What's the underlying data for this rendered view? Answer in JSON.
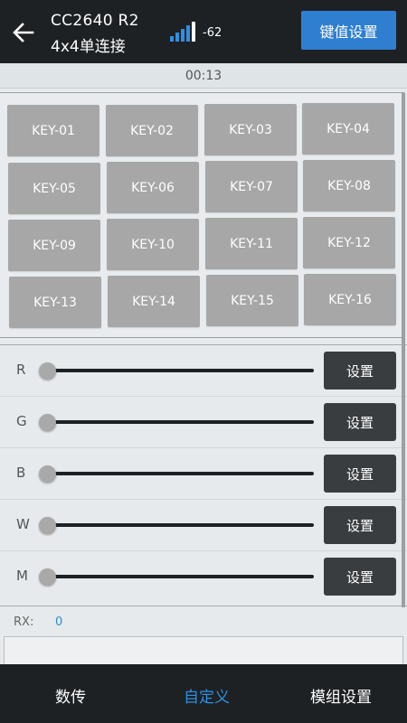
{
  "header": {
    "title_line1": "CC2640 R2",
    "title_line2": "4x4单连接",
    "rssi": "-62",
    "key_settings_button": "键值设置"
  },
  "timer": "00:13",
  "keys": [
    "KEY-01",
    "KEY-02",
    "KEY-03",
    "KEY-04",
    "KEY-05",
    "KEY-06",
    "KEY-07",
    "KEY-08",
    "KEY-09",
    "KEY-10",
    "KEY-11",
    "KEY-12",
    "KEY-13",
    "KEY-14",
    "KEY-15",
    "KEY-16"
  ],
  "sliders": [
    {
      "label": "R",
      "value": 0,
      "button": "设置"
    },
    {
      "label": "G",
      "value": 0,
      "button": "设置"
    },
    {
      "label": "B",
      "value": 0,
      "button": "设置"
    },
    {
      "label": "W",
      "value": 0,
      "button": "设置"
    },
    {
      "label": "M",
      "value": 0,
      "button": "设置"
    }
  ],
  "rx": {
    "label": "RX:",
    "value": "0"
  },
  "bottom_nav": {
    "tab1": "数传",
    "tab2": "自定义",
    "tab3": "模组设置"
  },
  "colors": {
    "header_bg": "#1e2124",
    "accent": "#2f7fd0",
    "key_bg": "#a7a7a7",
    "active_tab": "#2f8fe0"
  },
  "icons": {
    "back": "arrow-left-icon",
    "signal": "signal-strength-icon"
  }
}
